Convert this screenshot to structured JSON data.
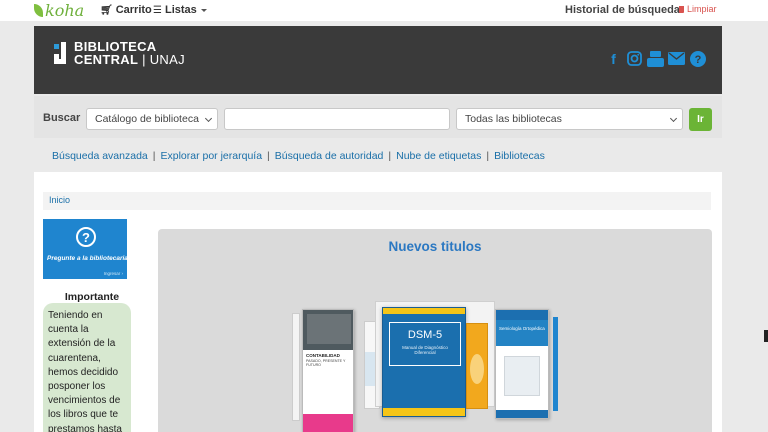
{
  "header": {
    "logo_text": "koha",
    "cart_label": "Carrito",
    "lists_label": "Listas",
    "history_label": "Historial de búsqueda",
    "clear_label": "Limpiar"
  },
  "banner": {
    "title_line1": "BIBLIOTECA",
    "title_line2a": "CENTRAL",
    "title_line2b": "UNAJ",
    "social_icons": [
      "facebook-icon",
      "instagram-icon",
      "youtube-icon",
      "mail-icon",
      "help-icon"
    ]
  },
  "search": {
    "label": "Buscar",
    "catalog_option": "Catálogo de biblioteca",
    "query_value": "",
    "library_option": "Todas las bibliotecas",
    "go_label": "Ir"
  },
  "more_searches": [
    "Búsqueda avanzada",
    "Explorar por jerarquía",
    "Búsqueda de autoridad",
    "Nube de etiquetas",
    "Bibliotecas"
  ],
  "breadcrumb": {
    "home": "Inicio"
  },
  "ask_librarian": {
    "text": "Pregunte a la bibliotecaria",
    "sub": "Ingresar ›"
  },
  "important": {
    "title": "Importante",
    "lines": [
      "Teniendo en",
      "cuenta la",
      "extensión de la",
      "cuarentena,",
      "hemos decidido",
      "posponer los",
      "vencimientos de",
      "los libros que te",
      "prestamos hasta"
    ]
  },
  "new_titles": {
    "heading": "Nuevos titulos",
    "covers": [
      {
        "title": "CONTABILIDAD",
        "subtitle": "PASADO, PRESENTE Y FUTURO"
      },
      {
        "title": "DSM-5",
        "subtitle": "Manual de Diagnóstico Diferencial"
      },
      {
        "title": "Semiología Ortopédica",
        "subtitle": ""
      }
    ]
  },
  "colors": {
    "accent_link": "#1a6fa8",
    "banner_bg": "#3a3a3a",
    "social_blue": "#1f8fd6",
    "go_green": "#6bb436",
    "clear_red": "#d9534f"
  }
}
